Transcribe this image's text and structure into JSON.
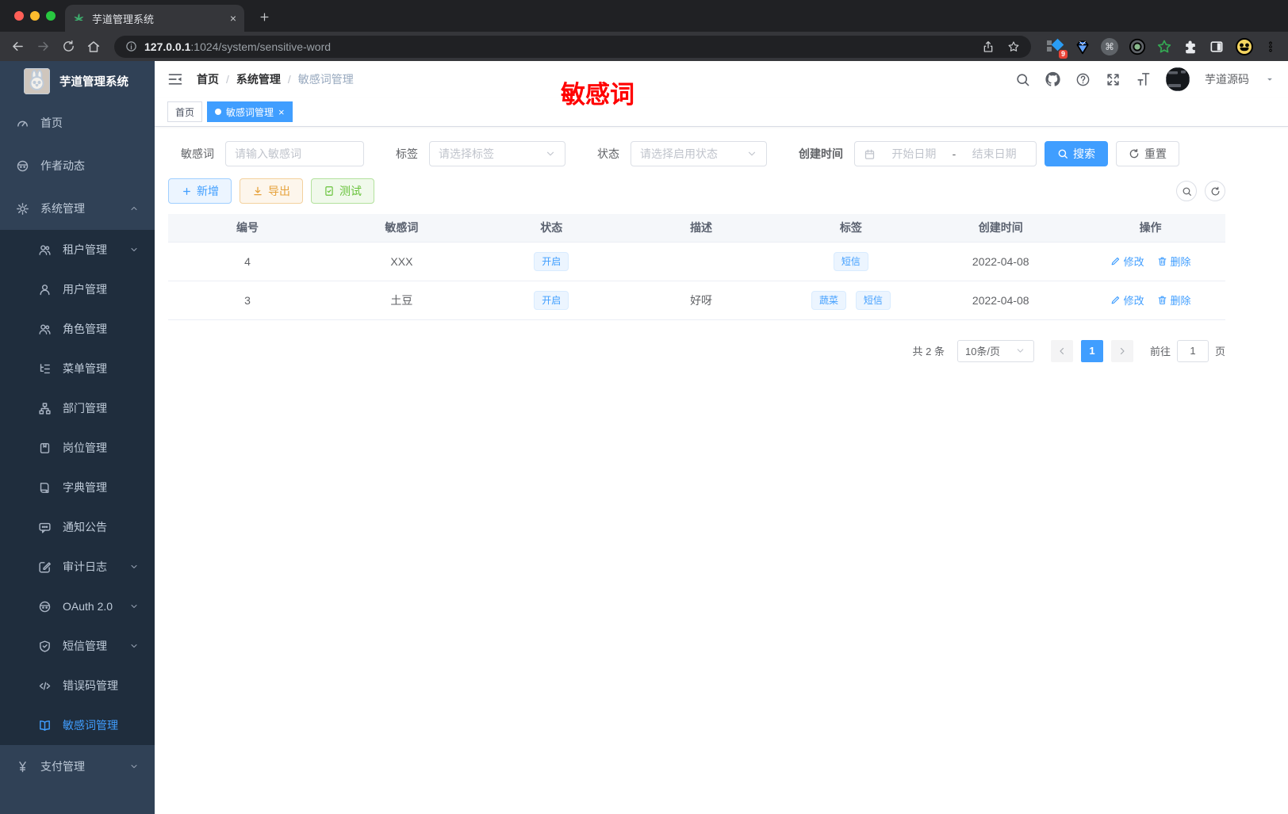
{
  "colors": {
    "accent": "#409eff",
    "annotation_red": "#ff0000",
    "warning": "#e6a23c",
    "success": "#67c23a",
    "sidebar_bg": "#304156",
    "submenu_bg": "#1f2d3d",
    "chrome_bg": "#202124",
    "toolbar_bg": "#35363a"
  },
  "browser": {
    "tab_title": "芋道管理系统",
    "url_host": "127.0.0.1",
    "url_path": ":1024/system/sensitive-word",
    "extension_badge": "9",
    "cmd_glyph": "⌘"
  },
  "sidebar": {
    "title": "芋道管理系统",
    "items": [
      {
        "label": "首页",
        "icon": "dashboard-icon"
      },
      {
        "label": "作者动态",
        "icon": "author-chat-icon"
      },
      {
        "label": "系统管理",
        "icon": "gear-icon"
      },
      {
        "label": "租户管理",
        "icon": "tenant-users-icon"
      },
      {
        "label": "用户管理",
        "icon": "user-icon"
      },
      {
        "label": "角色管理",
        "icon": "role-users-icon"
      },
      {
        "label": "菜单管理",
        "icon": "menu-tree-icon"
      },
      {
        "label": "部门管理",
        "icon": "org-chart-icon"
      },
      {
        "label": "岗位管理",
        "icon": "post-badge-icon"
      },
      {
        "label": "字典管理",
        "icon": "dictionary-icon"
      },
      {
        "label": "通知公告",
        "icon": "notice-icon"
      },
      {
        "label": "审计日志",
        "icon": "audit-log-icon"
      },
      {
        "label": "OAuth 2.0",
        "icon": "oauth-icon"
      },
      {
        "label": "短信管理",
        "icon": "sms-shield-icon"
      },
      {
        "label": "错误码管理",
        "icon": "error-code-icon"
      },
      {
        "label": "敏感词管理",
        "icon": "sensitive-word-icon"
      },
      {
        "label": "支付管理",
        "icon": "payment-icon"
      }
    ]
  },
  "header": {
    "breadcrumb": [
      "首页",
      "系统管理",
      "敏感词管理"
    ],
    "separator": "/",
    "user_name": "芋道源码"
  },
  "annotation": {
    "text": "敏感词"
  },
  "tabs": {
    "home": "首页",
    "active": "敏感词管理",
    "close": "×"
  },
  "filters": {
    "keyword_label": "敏感词",
    "keyword_placeholder": "请输入敏感词",
    "tag_label": "标签",
    "tag_placeholder": "请选择标签",
    "status_label": "状态",
    "status_placeholder": "请选择启用状态",
    "date_label": "创建时间",
    "date_start_placeholder": "开始日期",
    "date_separator": "-",
    "date_end_placeholder": "结束日期",
    "search_label": "搜索",
    "reset_label": "重置"
  },
  "toolbar": {
    "add_label": "新增",
    "export_label": "导出",
    "test_label": "测试"
  },
  "table": {
    "columns": [
      "编号",
      "敏感词",
      "状态",
      "描述",
      "标签",
      "创建时间",
      "操作"
    ],
    "edit_label": "修改",
    "delete_label": "删除",
    "rows": [
      {
        "id": "4",
        "word": "XXX",
        "status": "开启",
        "description": "",
        "tags": [
          "短信"
        ],
        "create_time": "2022-04-08"
      },
      {
        "id": "3",
        "word": "土豆",
        "status": "开启",
        "description": "好呀",
        "tags": [
          "蔬菜",
          "短信"
        ],
        "create_time": "2022-04-08"
      }
    ]
  },
  "pagination": {
    "total": "共 2 条",
    "size": "10条/页",
    "page": "1",
    "goto_label": "前往",
    "goto_value": "1",
    "unit_label": "页"
  }
}
